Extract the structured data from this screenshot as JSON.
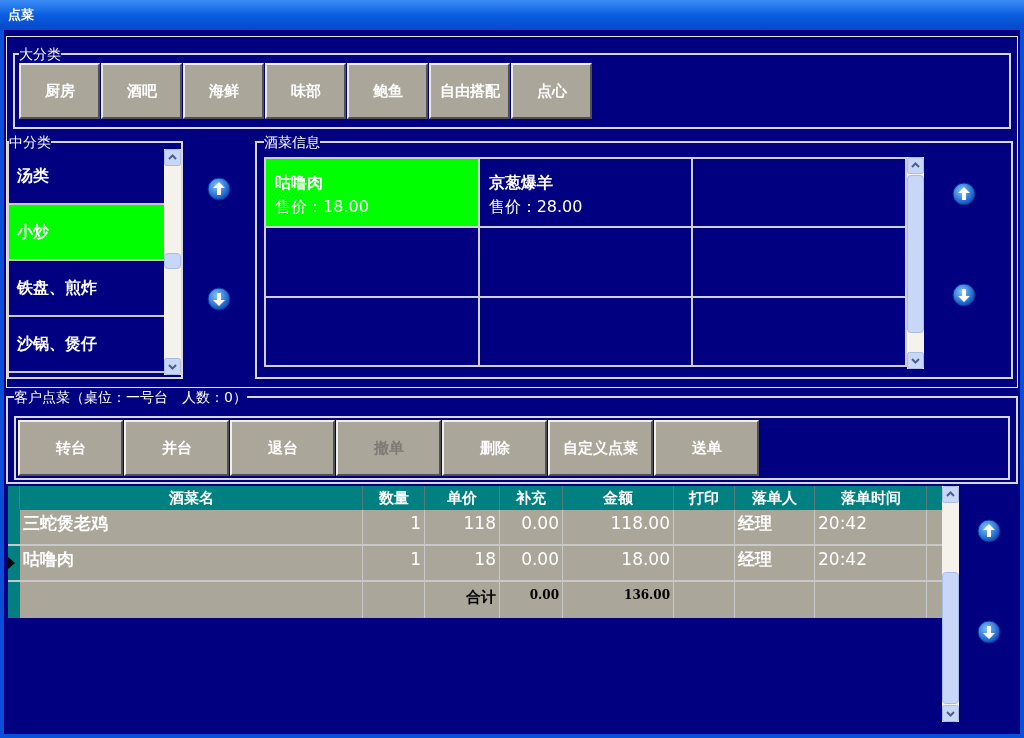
{
  "window": {
    "title": "点菜"
  },
  "main_categories": {
    "legend": "大分类",
    "items": [
      {
        "label": "厨房"
      },
      {
        "label": "酒吧"
      },
      {
        "label": "海鲜"
      },
      {
        "label": "味部"
      },
      {
        "label": "鲍鱼"
      },
      {
        "label": "自由搭配"
      },
      {
        "label": "点心"
      }
    ]
  },
  "sub_categories": {
    "legend": "中分类",
    "items": [
      {
        "label": "汤类",
        "selected": false
      },
      {
        "label": "小炒",
        "selected": true
      },
      {
        "label": "铁盘、煎炸",
        "selected": false
      },
      {
        "label": "沙锅、煲仔",
        "selected": false
      }
    ]
  },
  "dishes": {
    "legend": "酒菜信息",
    "items": [
      {
        "name": "咕噜肉",
        "price": "售价：18.00",
        "selected": true
      },
      {
        "name": "京葱爆羊",
        "price": "售价：28.00",
        "selected": false
      }
    ]
  },
  "order": {
    "legend": "客户点菜（桌位：一号台　人数：0）",
    "buttons": [
      {
        "label": "转台",
        "disabled": false
      },
      {
        "label": "并台",
        "disabled": false
      },
      {
        "label": "退台",
        "disabled": false
      },
      {
        "label": "撤单",
        "disabled": true
      },
      {
        "label": "删除",
        "disabled": false
      },
      {
        "label": "自定义点菜",
        "disabled": false
      },
      {
        "label": "送单",
        "disabled": false
      }
    ]
  },
  "table": {
    "columns": [
      "酒菜名",
      "数量",
      "单价",
      "补充",
      "金额",
      "打印",
      "落单人",
      "落单时间"
    ],
    "rows": [
      {
        "selected": false,
        "cells": [
          "三蛇煲老鸡",
          "1",
          "118",
          "0.00",
          "118.00",
          "",
          "经理",
          "20:42"
        ]
      },
      {
        "selected": true,
        "cells": [
          "咕噜肉",
          "1",
          "18",
          "0.00",
          "18.00",
          "",
          "经理",
          "20:42"
        ]
      }
    ],
    "total": {
      "label": "合计",
      "supplement": "0.00",
      "amount": "136.00"
    }
  }
}
